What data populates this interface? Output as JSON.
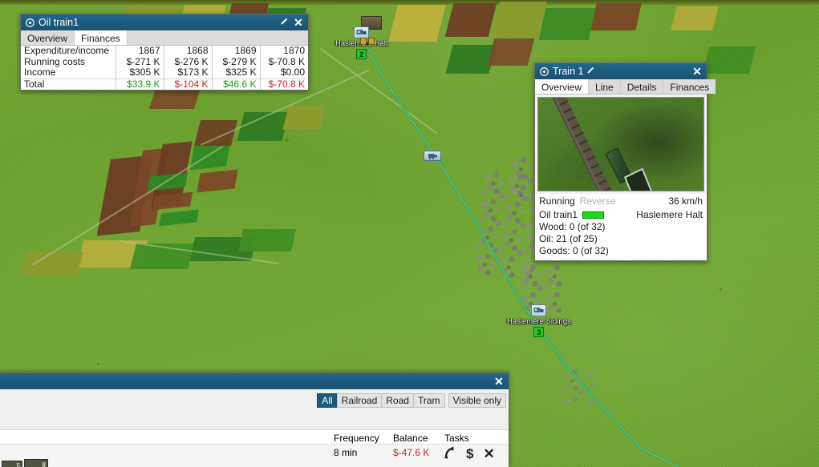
{
  "finances_window": {
    "title": "Oil train1",
    "gear_icon": "gear-icon",
    "edit_icon": "pencil-icon",
    "close_icon": "close-icon",
    "tabs": [
      {
        "label": "Overview",
        "active": false
      },
      {
        "label": "Finances",
        "active": true
      }
    ],
    "table": {
      "header_label": "Expenditure/income",
      "years": [
        "1867",
        "1868",
        "1869",
        "1870"
      ],
      "rows": [
        {
          "label": "Running costs",
          "values": [
            "$-271 K",
            "$-276 K",
            "$-279 K",
            "$-70.8 K"
          ],
          "tones": [
            "neutral",
            "neutral",
            "neutral",
            "neutral"
          ]
        },
        {
          "label": "Income",
          "values": [
            "$305 K",
            "$173 K",
            "$325 K",
            "$0.00"
          ],
          "tones": [
            "neutral",
            "neutral",
            "neutral",
            "neutral"
          ]
        },
        {
          "label": "Total",
          "values": [
            "$33.9 K",
            "$-104 K",
            "$46.6 K",
            "$-70.8 K"
          ],
          "tones": [
            "pos",
            "neg",
            "pos",
            "neg"
          ]
        }
      ]
    }
  },
  "train_window": {
    "title": "Train 1",
    "gear_icon": "gear-icon",
    "edit_icon": "pencil-icon",
    "close_icon": "close-icon",
    "tabs": [
      {
        "label": "Overview",
        "active": true
      },
      {
        "label": "Line",
        "active": false
      },
      {
        "label": "Details",
        "active": false
      },
      {
        "label": "Finances",
        "active": false
      }
    ],
    "preview_alt": "train-preview-viewport",
    "status": "Running",
    "reverse_label": "Reverse",
    "speed": "36 km/h",
    "line_name": "Oil train1",
    "destination": "Haslemere Halt",
    "cargo": [
      "Wood: 0 (of 32)",
      "Oil: 21 (of 25)",
      "Goods: 0 (of 32)"
    ]
  },
  "vehicle_list_window": {
    "close_icon": "close-icon",
    "filters": [
      {
        "label": "All",
        "selected": true
      },
      {
        "label": "Railroad",
        "selected": false
      },
      {
        "label": "Road",
        "selected": false
      },
      {
        "label": "Tram",
        "selected": false
      }
    ],
    "visible_only_label": "Visible only",
    "columns": {
      "frequency": "Frequency",
      "balance": "Balance",
      "tasks": "Tasks"
    },
    "row": {
      "frequency": "8 min",
      "balance": "$-47.6 K",
      "balance_tone": "neg",
      "vehicle_cars": [
        "5",
        "8"
      ]
    },
    "task_icons": [
      {
        "name": "goto-arrow-icon",
        "glyph": "⤴"
      },
      {
        "name": "sell-dollar-icon",
        "glyph": "$"
      },
      {
        "name": "delete-x-icon",
        "glyph": "✕"
      }
    ]
  },
  "map": {
    "stations": [
      {
        "name": "Haslemere Halt",
        "badge": "2"
      },
      {
        "name": "Haslemere Sidings",
        "badge": "3"
      }
    ],
    "train_marker_icon": "train-marker-icon"
  },
  "colors": {
    "titlebar": "#1d5a7a",
    "accent_selected": "#1d5a7a",
    "positive": "#12a014",
    "negative": "#d42020",
    "cargo_green": "#14e014",
    "station_badge": "#22c722",
    "map_grass": "#6aa52b"
  }
}
